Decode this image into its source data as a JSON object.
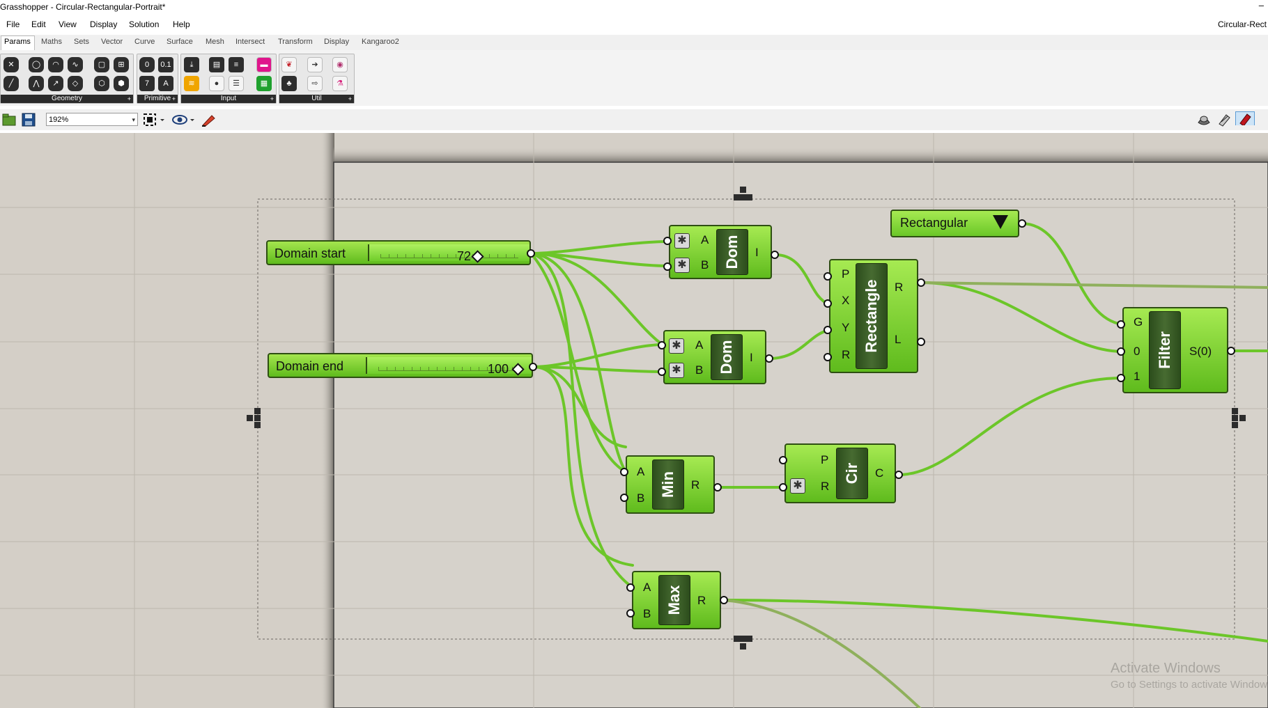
{
  "window": {
    "title": "Grasshopper - Circular-Rectangular-Portrait*",
    "document_tab": "Circular-Rect",
    "minimize_glyph": "–"
  },
  "menu": [
    "File",
    "Edit",
    "View",
    "Display",
    "Solution",
    "Help"
  ],
  "tabs": [
    "Params",
    "Maths",
    "Sets",
    "Vector",
    "Curve",
    "Surface",
    "Mesh",
    "Intersect",
    "Transform",
    "Display",
    "Kangaroo2"
  ],
  "active_tab": "Params",
  "ribbon_groups": [
    {
      "label": "Geometry",
      "more": "+"
    },
    {
      "label": "Primitive",
      "more": "+"
    },
    {
      "label": "Input",
      "more": "+"
    },
    {
      "label": "Util",
      "more": "+"
    }
  ],
  "toolbar": {
    "zoom": "192%"
  },
  "canvas": {
    "sliders": [
      {
        "name": "Domain start",
        "value": "72"
      },
      {
        "name": "Domain end",
        "value": "100"
      }
    ],
    "value_list": {
      "value": "Rectangular"
    },
    "components": {
      "dom1": {
        "label": "Dom",
        "inputs": [
          "A",
          "B"
        ],
        "outputs": [
          "I"
        ]
      },
      "dom2": {
        "label": "Dom",
        "inputs": [
          "A",
          "B"
        ],
        "outputs": [
          "I"
        ]
      },
      "rect": {
        "label": "Rectangle",
        "inputs": [
          "P",
          "X",
          "Y",
          "R"
        ],
        "outputs": [
          "R",
          "L"
        ]
      },
      "min": {
        "label": "Min",
        "inputs": [
          "A",
          "B"
        ],
        "outputs": [
          "R"
        ]
      },
      "cir": {
        "label": "Cir",
        "inputs": [
          "P",
          "R"
        ],
        "outputs": [
          "C"
        ]
      },
      "max": {
        "label": "Max",
        "inputs": [
          "A",
          "B"
        ],
        "outputs": [
          "R"
        ]
      },
      "filter": {
        "label": "Filter",
        "inputs": [
          "G",
          "0",
          "1"
        ],
        "outputs": [
          "S(0)"
        ]
      }
    },
    "wire_color": "#6cc629",
    "watermark": {
      "line1": "Activate Windows",
      "line2": "Go to Settings to activate Window"
    }
  }
}
